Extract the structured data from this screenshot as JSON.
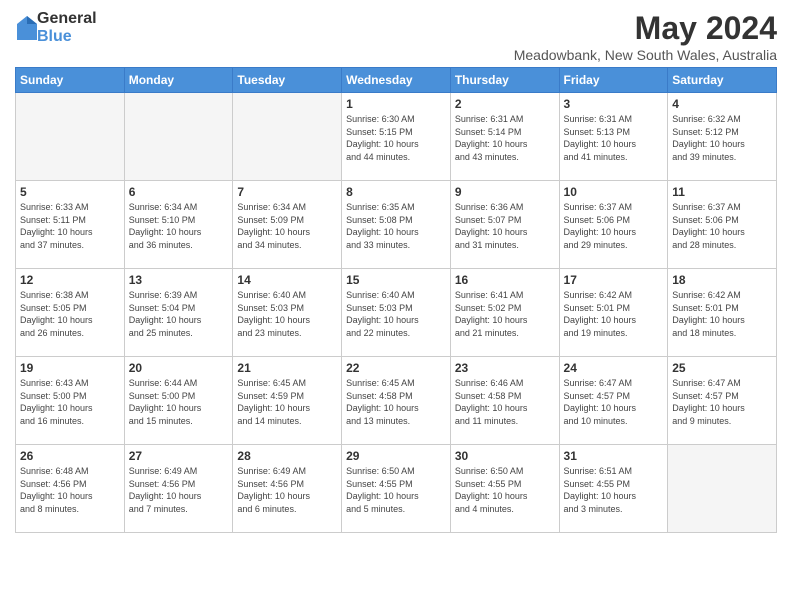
{
  "logo": {
    "general": "General",
    "blue": "Blue"
  },
  "header": {
    "month_year": "May 2024",
    "location": "Meadowbank, New South Wales, Australia"
  },
  "days_of_week": [
    "Sunday",
    "Monday",
    "Tuesday",
    "Wednesday",
    "Thursday",
    "Friday",
    "Saturday"
  ],
  "weeks": [
    [
      {
        "day": "",
        "info": ""
      },
      {
        "day": "",
        "info": ""
      },
      {
        "day": "",
        "info": ""
      },
      {
        "day": "1",
        "info": "Sunrise: 6:30 AM\nSunset: 5:15 PM\nDaylight: 10 hours\nand 44 minutes."
      },
      {
        "day": "2",
        "info": "Sunrise: 6:31 AM\nSunset: 5:14 PM\nDaylight: 10 hours\nand 43 minutes."
      },
      {
        "day": "3",
        "info": "Sunrise: 6:31 AM\nSunset: 5:13 PM\nDaylight: 10 hours\nand 41 minutes."
      },
      {
        "day": "4",
        "info": "Sunrise: 6:32 AM\nSunset: 5:12 PM\nDaylight: 10 hours\nand 39 minutes."
      }
    ],
    [
      {
        "day": "5",
        "info": "Sunrise: 6:33 AM\nSunset: 5:11 PM\nDaylight: 10 hours\nand 37 minutes."
      },
      {
        "day": "6",
        "info": "Sunrise: 6:34 AM\nSunset: 5:10 PM\nDaylight: 10 hours\nand 36 minutes."
      },
      {
        "day": "7",
        "info": "Sunrise: 6:34 AM\nSunset: 5:09 PM\nDaylight: 10 hours\nand 34 minutes."
      },
      {
        "day": "8",
        "info": "Sunrise: 6:35 AM\nSunset: 5:08 PM\nDaylight: 10 hours\nand 33 minutes."
      },
      {
        "day": "9",
        "info": "Sunrise: 6:36 AM\nSunset: 5:07 PM\nDaylight: 10 hours\nand 31 minutes."
      },
      {
        "day": "10",
        "info": "Sunrise: 6:37 AM\nSunset: 5:06 PM\nDaylight: 10 hours\nand 29 minutes."
      },
      {
        "day": "11",
        "info": "Sunrise: 6:37 AM\nSunset: 5:06 PM\nDaylight: 10 hours\nand 28 minutes."
      }
    ],
    [
      {
        "day": "12",
        "info": "Sunrise: 6:38 AM\nSunset: 5:05 PM\nDaylight: 10 hours\nand 26 minutes."
      },
      {
        "day": "13",
        "info": "Sunrise: 6:39 AM\nSunset: 5:04 PM\nDaylight: 10 hours\nand 25 minutes."
      },
      {
        "day": "14",
        "info": "Sunrise: 6:40 AM\nSunset: 5:03 PM\nDaylight: 10 hours\nand 23 minutes."
      },
      {
        "day": "15",
        "info": "Sunrise: 6:40 AM\nSunset: 5:03 PM\nDaylight: 10 hours\nand 22 minutes."
      },
      {
        "day": "16",
        "info": "Sunrise: 6:41 AM\nSunset: 5:02 PM\nDaylight: 10 hours\nand 21 minutes."
      },
      {
        "day": "17",
        "info": "Sunrise: 6:42 AM\nSunset: 5:01 PM\nDaylight: 10 hours\nand 19 minutes."
      },
      {
        "day": "18",
        "info": "Sunrise: 6:42 AM\nSunset: 5:01 PM\nDaylight: 10 hours\nand 18 minutes."
      }
    ],
    [
      {
        "day": "19",
        "info": "Sunrise: 6:43 AM\nSunset: 5:00 PM\nDaylight: 10 hours\nand 16 minutes."
      },
      {
        "day": "20",
        "info": "Sunrise: 6:44 AM\nSunset: 5:00 PM\nDaylight: 10 hours\nand 15 minutes."
      },
      {
        "day": "21",
        "info": "Sunrise: 6:45 AM\nSunset: 4:59 PM\nDaylight: 10 hours\nand 14 minutes."
      },
      {
        "day": "22",
        "info": "Sunrise: 6:45 AM\nSunset: 4:58 PM\nDaylight: 10 hours\nand 13 minutes."
      },
      {
        "day": "23",
        "info": "Sunrise: 6:46 AM\nSunset: 4:58 PM\nDaylight: 10 hours\nand 11 minutes."
      },
      {
        "day": "24",
        "info": "Sunrise: 6:47 AM\nSunset: 4:57 PM\nDaylight: 10 hours\nand 10 minutes."
      },
      {
        "day": "25",
        "info": "Sunrise: 6:47 AM\nSunset: 4:57 PM\nDaylight: 10 hours\nand 9 minutes."
      }
    ],
    [
      {
        "day": "26",
        "info": "Sunrise: 6:48 AM\nSunset: 4:56 PM\nDaylight: 10 hours\nand 8 minutes."
      },
      {
        "day": "27",
        "info": "Sunrise: 6:49 AM\nSunset: 4:56 PM\nDaylight: 10 hours\nand 7 minutes."
      },
      {
        "day": "28",
        "info": "Sunrise: 6:49 AM\nSunset: 4:56 PM\nDaylight: 10 hours\nand 6 minutes."
      },
      {
        "day": "29",
        "info": "Sunrise: 6:50 AM\nSunset: 4:55 PM\nDaylight: 10 hours\nand 5 minutes."
      },
      {
        "day": "30",
        "info": "Sunrise: 6:50 AM\nSunset: 4:55 PM\nDaylight: 10 hours\nand 4 minutes."
      },
      {
        "day": "31",
        "info": "Sunrise: 6:51 AM\nSunset: 4:55 PM\nDaylight: 10 hours\nand 3 minutes."
      },
      {
        "day": "",
        "info": ""
      }
    ]
  ]
}
